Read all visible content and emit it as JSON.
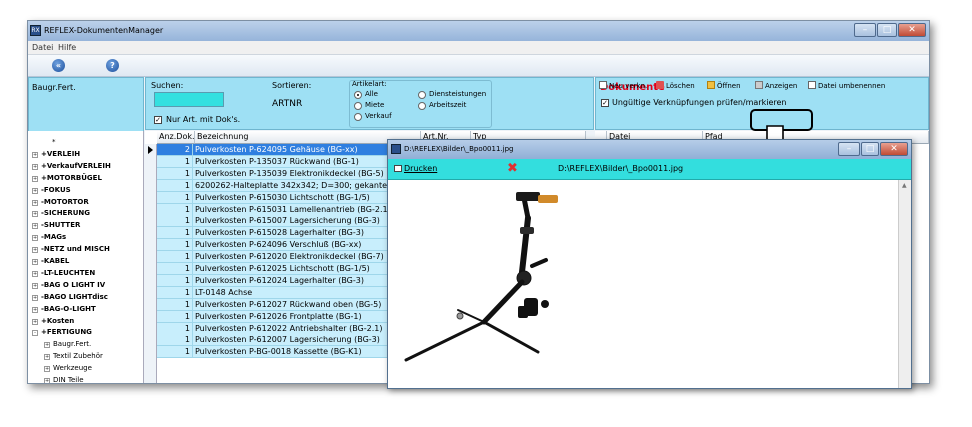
{
  "window": {
    "title": "REFLEX-DokumentenManager",
    "app_icon_text": "RX"
  },
  "menu": [
    "Datei",
    "Hilfe"
  ],
  "nav": {
    "back_glyph": "«",
    "help_glyph": "?"
  },
  "left_panel": {
    "title": "Baugr.Fert."
  },
  "search": {
    "label": "Suchen:",
    "value": "",
    "only_docs_label": "Nur Art. mit Dok's.",
    "sort_label": "Sortieren:",
    "sort_value": "ARTNR",
    "artikelart_label": "Artikelart:",
    "options": [
      "Alle",
      "Miete",
      "Verkauf",
      "Diensteistungen",
      "Arbeitszeit"
    ],
    "selected": "Alle"
  },
  "documents": {
    "title": "Dokumente",
    "check_label": "Ungültige Verknüpfungen prüfen/markieren",
    "toolbar": [
      "Neu verkn.",
      "Löschen",
      "Öffnen",
      "Anzeigen",
      "Datei umbenennen"
    ],
    "columns": [
      "Datei",
      "Pfad"
    ]
  },
  "tree": [
    {
      "label": "*",
      "bold": false,
      "indent": 0,
      "sign": ""
    },
    {
      "label": "+VERLEIH",
      "bold": true,
      "indent": 0,
      "sign": "+"
    },
    {
      "label": "+VerkaufVERLEIH",
      "bold": true,
      "indent": 0,
      "sign": "+"
    },
    {
      "label": "+MOTORBÜGEL",
      "bold": true,
      "indent": 0,
      "sign": "+"
    },
    {
      "label": "-FOKUS",
      "bold": true,
      "indent": 0,
      "sign": "+"
    },
    {
      "label": "-MOTORTOR",
      "bold": true,
      "indent": 0,
      "sign": "+"
    },
    {
      "label": "-SICHERUNG",
      "bold": true,
      "indent": 0,
      "sign": "+"
    },
    {
      "label": "-SHUTTER",
      "bold": true,
      "indent": 0,
      "sign": "+"
    },
    {
      "label": "-MAGs",
      "bold": true,
      "indent": 0,
      "sign": "+"
    },
    {
      "label": "-NETZ und MISCH",
      "bold": true,
      "indent": 0,
      "sign": "+"
    },
    {
      "label": "-KABEL",
      "bold": true,
      "indent": 0,
      "sign": "+"
    },
    {
      "label": "-LT-LEUCHTEN",
      "bold": true,
      "indent": 0,
      "sign": "+"
    },
    {
      "label": "-BAG O LIGHT IV",
      "bold": true,
      "indent": 0,
      "sign": "+"
    },
    {
      "label": "-BAGO LIGHTdisc",
      "bold": true,
      "indent": 0,
      "sign": "+"
    },
    {
      "label": "-BAG-O-LIGHT",
      "bold": true,
      "indent": 0,
      "sign": "+"
    },
    {
      "label": "+Kosten",
      "bold": true,
      "indent": 0,
      "sign": "+"
    },
    {
      "label": "+FERTIGUNG",
      "bold": true,
      "indent": 0,
      "sign": "-"
    },
    {
      "label": "Baugr.Fert.",
      "bold": false,
      "indent": 1,
      "sign": "+"
    },
    {
      "label": "Textil Zubehör",
      "bold": false,
      "indent": 1,
      "sign": "+"
    },
    {
      "label": "Werkzeuge",
      "bold": false,
      "indent": 1,
      "sign": "+"
    },
    {
      "label": "DIN Teile",
      "bold": false,
      "indent": 1,
      "sign": "+"
    }
  ],
  "grid": {
    "columns": [
      "Anz.Dok.",
      "Bezeichnung",
      "Art.Nr.",
      "Typ"
    ],
    "rows": [
      {
        "n": "2",
        "d": "Pulverkosten  P-624095 Gehäuse (BG-xx)"
      },
      {
        "n": "1",
        "d": "Pulverkosten  P-135037 Rückwand (BG-1)"
      },
      {
        "n": "1",
        "d": "Pulverkosten  P-135039 Elektronikdeckel (BG-5)"
      },
      {
        "n": "1",
        "d": "6200262-Halteplatte 342x342; D=300;  gekantet,"
      },
      {
        "n": "1",
        "d": "Pulverkosten  P-615030 Lichtschott (BG-1/5)"
      },
      {
        "n": "1",
        "d": "Pulverkosten  P-615031 Lamellenantrieb (BG-2.1)"
      },
      {
        "n": "1",
        "d": "Pulverkosten  P-615007 Lagersicherung (BG-3)"
      },
      {
        "n": "1",
        "d": "Pulverkosten  P-615028 Lagerhalter (BG-3)"
      },
      {
        "n": "1",
        "d": "Pulverkosten  P-624096 Verschluß (BG-xx)"
      },
      {
        "n": "1",
        "d": "Pulverkosten  P-612020 Elektronikdeckel (BG-7)"
      },
      {
        "n": "1",
        "d": "Pulverkosten  P-612025 Lichtschott (BG-1/5)"
      },
      {
        "n": "1",
        "d": "Pulverkosten P-612024 Lagerhalter (BG-3)"
      },
      {
        "n": "1",
        "d": "LT-0148 Achse"
      },
      {
        "n": "1",
        "d": "Pulverkosten  P-612027 Rückwand oben (BG-5)"
      },
      {
        "n": "1",
        "d": "Pulverkosten P-612026 Frontplatte (BG-1)"
      },
      {
        "n": "1",
        "d": "Pulverkosten P-612022 Antriebshalter (BG-2.1)"
      },
      {
        "n": "1",
        "d": "Pulverkosten P-612007 Lagersicherung (BG-3)"
      },
      {
        "n": "1",
        "d": "Pulverkosten  P-BG-0018 Kassette (BG-K1)"
      }
    ]
  },
  "image_window": {
    "title": "D:\\REFLEX\\Bilder\\_Bpo0011.jpg",
    "print_label": "Drucken",
    "path": "D:\\REFLEX\\Bilder\\_Bpo0011.jpg"
  },
  "colors": {
    "accent_cyan": "#33e0e0",
    "panel": "#9ee0f4",
    "row": "#c8eefc",
    "selected": "#2f7fe0",
    "docs_title": "#e0001a"
  }
}
